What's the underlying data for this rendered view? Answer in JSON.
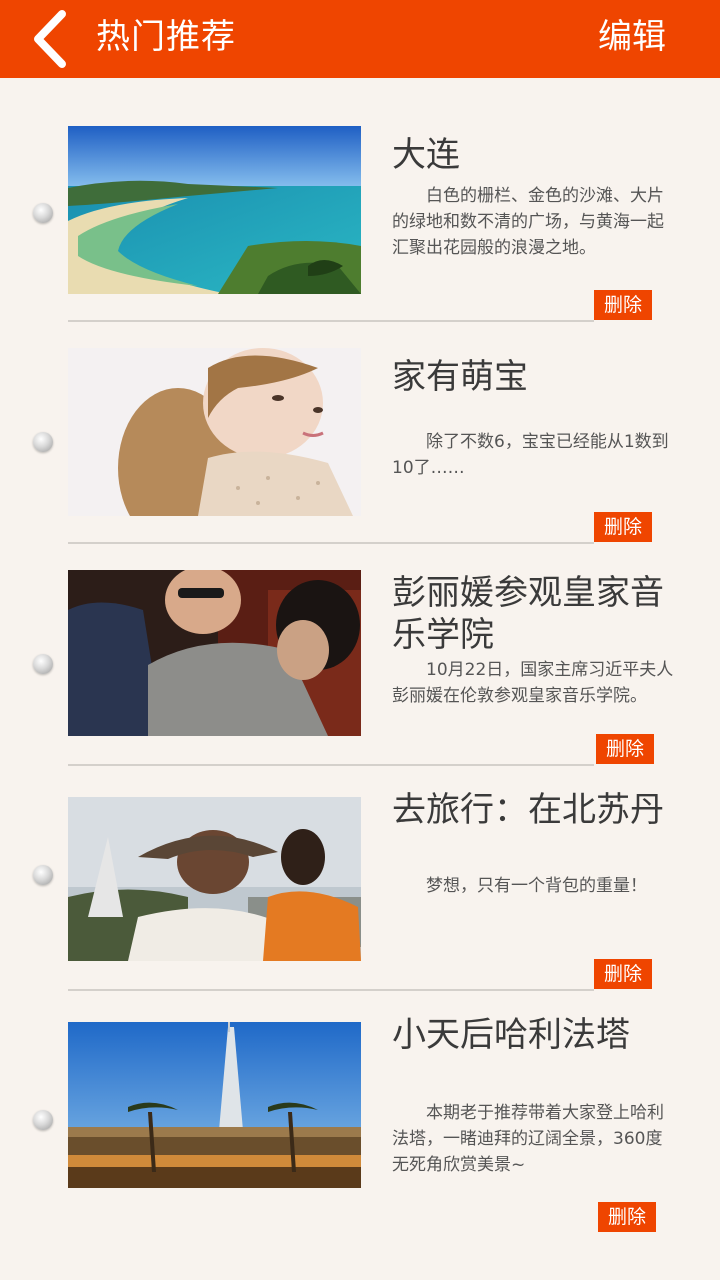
{
  "header": {
    "title": "热门推荐",
    "edit_label": "编辑",
    "back_icon": "chevron-left-icon",
    "bg_color": "#ef4500"
  },
  "items": [
    {
      "title": "大连",
      "desc": "白色的栅栏、金色的沙滩、大片的绿地和数不清的广场，与黄海一起汇聚出花园般的浪漫之地。",
      "delete_label": "删除"
    },
    {
      "title": "家有萌宝",
      "desc": "除了不数6，宝宝已经能从1数到10了……",
      "delete_label": "删除"
    },
    {
      "title": "彭丽媛参观皇家音乐学院",
      "desc": "10月22日，国家主席习近平夫人彭丽媛在伦敦参观皇家音乐学院。",
      "delete_label": "删除"
    },
    {
      "title": "去旅行：在北苏丹",
      "desc": "梦想，只有一个背包的重量！",
      "delete_label": "删除"
    },
    {
      "title": "小天后哈利法塔",
      "desc": "本期老于推荐带着大家登上哈利法塔，一睹迪拜的辽阔全景，360度无死角欣赏美景~",
      "delete_label": "删除"
    }
  ],
  "accent_color": "#ef4500"
}
